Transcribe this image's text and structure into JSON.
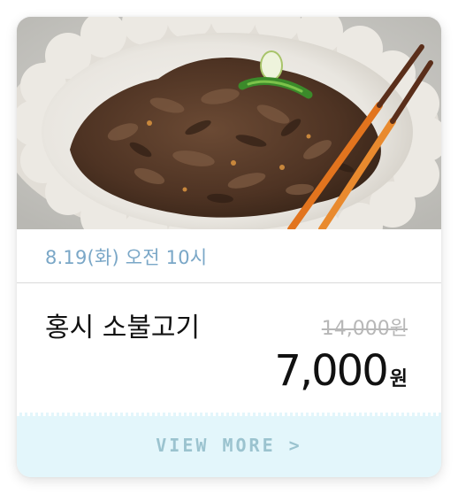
{
  "card": {
    "photo_alt": "bulgogi-photo",
    "date": "8.19(화) 오전 10시",
    "product_name": "홍시 소불고기",
    "original_price": "14,000원",
    "sale_price_value": "7,000",
    "sale_price_unit": "원",
    "more_label": "VIEW MORE >"
  },
  "colors": {
    "date_text": "#7aa7c7",
    "more_bg": "#e3f6fb",
    "more_text": "#9bc3cf",
    "chopsticks": "#e2741e"
  }
}
